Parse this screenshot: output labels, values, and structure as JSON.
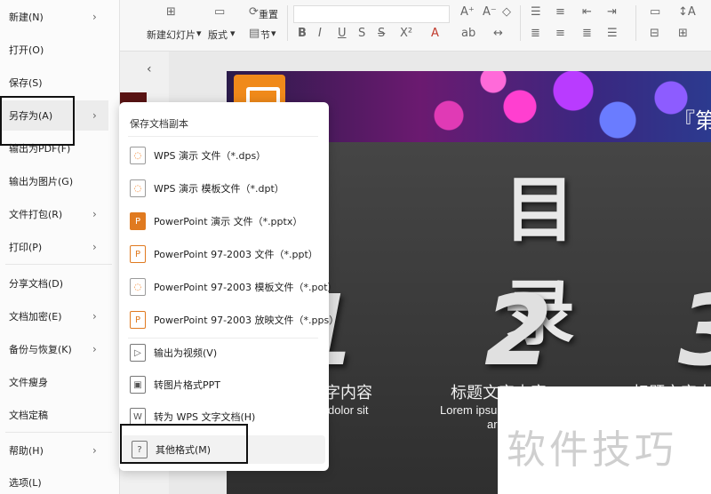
{
  "ribbon": {
    "new_slide_label": "新建幻灯片",
    "layout_label": "版式",
    "section_label": "节",
    "reset_label": "重置"
  },
  "file_menu": {
    "items": [
      {
        "label": "新建(N)",
        "has_sub": true
      },
      {
        "label": "打开(O)",
        "has_sub": false
      },
      {
        "label": "保存(S)",
        "has_sub": false
      },
      {
        "label": "另存为(A)",
        "has_sub": true
      },
      {
        "label": "输出为PDF(F)",
        "has_sub": false
      },
      {
        "label": "输出为图片(G)",
        "has_sub": false
      },
      {
        "label": "文件打包(R)",
        "has_sub": true
      },
      {
        "label": "打印(P)",
        "has_sub": true
      },
      {
        "label": "分享文档(D)",
        "has_sub": false
      },
      {
        "label": "文档加密(E)",
        "has_sub": true
      },
      {
        "label": "备份与恢复(K)",
        "has_sub": true
      },
      {
        "label": "文件瘦身",
        "has_sub": false
      },
      {
        "label": "文档定稿",
        "has_sub": false
      },
      {
        "label": "帮助(H)",
        "has_sub": true
      },
      {
        "label": "选项(L)",
        "has_sub": false
      }
    ]
  },
  "save_as_menu": {
    "header": "保存文档副本",
    "items": [
      {
        "label": "WPS 演示 文件（*.dps）",
        "icon": "wps-file-icon"
      },
      {
        "label": "WPS 演示 模板文件（*.dpt）",
        "icon": "wps-template-icon"
      },
      {
        "label": "PowerPoint 演示 文件（*.pptx）",
        "icon": "ppt-file-icon"
      },
      {
        "label": "PowerPoint 97-2003 文件（*.ppt）",
        "icon": "ppt-legacy-icon"
      },
      {
        "label": "PowerPoint 97-2003 模板文件（*.pot）",
        "icon": "ppt-template-icon"
      },
      {
        "label": "PowerPoint 97-2003 放映文件（*.pps）",
        "icon": "ppt-show-icon"
      },
      {
        "label": "输出为视频(V)",
        "icon": "video-icon"
      },
      {
        "label": "转图片格式PPT",
        "icon": "image-ppt-icon"
      },
      {
        "label": "转为 WPS 文字文档(H)",
        "icon": "word-doc-icon"
      },
      {
        "label": "其他格式(M)",
        "icon": "question-icon"
      }
    ]
  },
  "slide": {
    "corner_text": "『第",
    "title": "目录",
    "num1": "1",
    "num2": "2",
    "num3": "3",
    "sub1": "字内容",
    "sub2": "标题文字内容",
    "sub3": "标题文字内",
    "lorem1": "dolor sit",
    "lorem2": "Lorem ipsu",
    "lorem2b": "ar"
  },
  "watermark": "软件技巧"
}
